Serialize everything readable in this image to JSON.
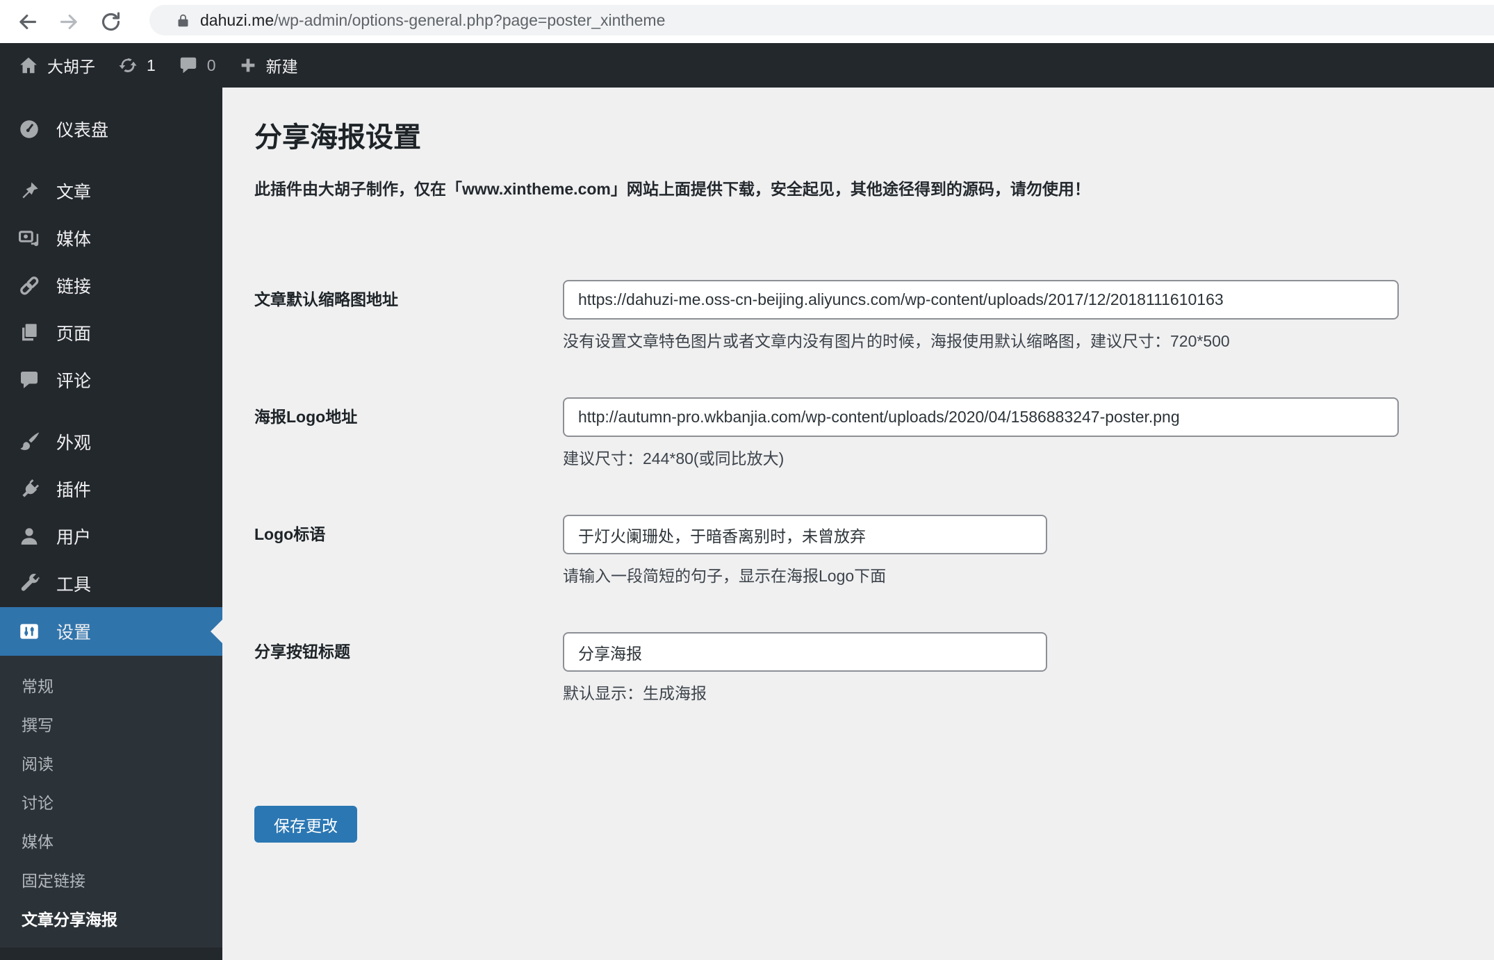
{
  "browser": {
    "url_domain": "dahuzi.me",
    "url_path": "/wp-admin/options-general.php?page=poster_xintheme"
  },
  "admin_bar": {
    "site_name": "大胡子",
    "update_count": "1",
    "comment_count": "0",
    "new_label": "新建"
  },
  "sidebar": {
    "items": [
      {
        "label": "仪表盘",
        "icon": "dashboard-icon"
      },
      {
        "label": "文章",
        "icon": "pin-icon"
      },
      {
        "label": "媒体",
        "icon": "media-icon"
      },
      {
        "label": "链接",
        "icon": "link-icon"
      },
      {
        "label": "页面",
        "icon": "pages-icon"
      },
      {
        "label": "评论",
        "icon": "comments-icon"
      },
      {
        "label": "外观",
        "icon": "brush-icon"
      },
      {
        "label": "插件",
        "icon": "plugin-icon"
      },
      {
        "label": "用户",
        "icon": "users-icon"
      },
      {
        "label": "工具",
        "icon": "tools-icon"
      },
      {
        "label": "设置",
        "icon": "settings-icon",
        "active": true
      }
    ],
    "submenu": [
      "常规",
      "撰写",
      "阅读",
      "讨论",
      "媒体",
      "固定链接",
      "文章分享海报"
    ],
    "active_submenu": "文章分享海报"
  },
  "main": {
    "title": "分享海报设置",
    "notice": "此插件由大胡子制作，仅在「www.xintheme.com」网站上面提供下载，安全起见，其他途径得到的源码，请勿使用！",
    "fields": [
      {
        "label": "文章默认缩略图地址",
        "value": "https://dahuzi-me.oss-cn-beijing.aliyuncs.com/wp-content/uploads/2017/12/2018111610163",
        "help": "没有设置文章特色图片或者文章内没有图片的时候，海报使用默认缩略图，建议尺寸：720*500"
      },
      {
        "label": "海报Logo地址",
        "value": "http://autumn-pro.wkbanjia.com/wp-content/uploads/2020/04/1586883247-poster.png",
        "help": "建议尺寸：244*80(或同比放大)"
      },
      {
        "label": "Logo标语",
        "value": "于灯火阑珊处，于暗香离别时，未曾放弃",
        "help": "请输入一段简短的句子，显示在海报Logo下面"
      },
      {
        "label": "分享按钮标题",
        "value": "分享海报",
        "help": "默认显示：生成海报"
      }
    ],
    "save_label": "保存更改"
  },
  "colors": {
    "admin_dark": "#23282d",
    "submenu_bg": "#2c3338",
    "active_blue": "#3074ac",
    "button_blue": "#2b77b3",
    "content_bg": "#f0f0f1"
  }
}
